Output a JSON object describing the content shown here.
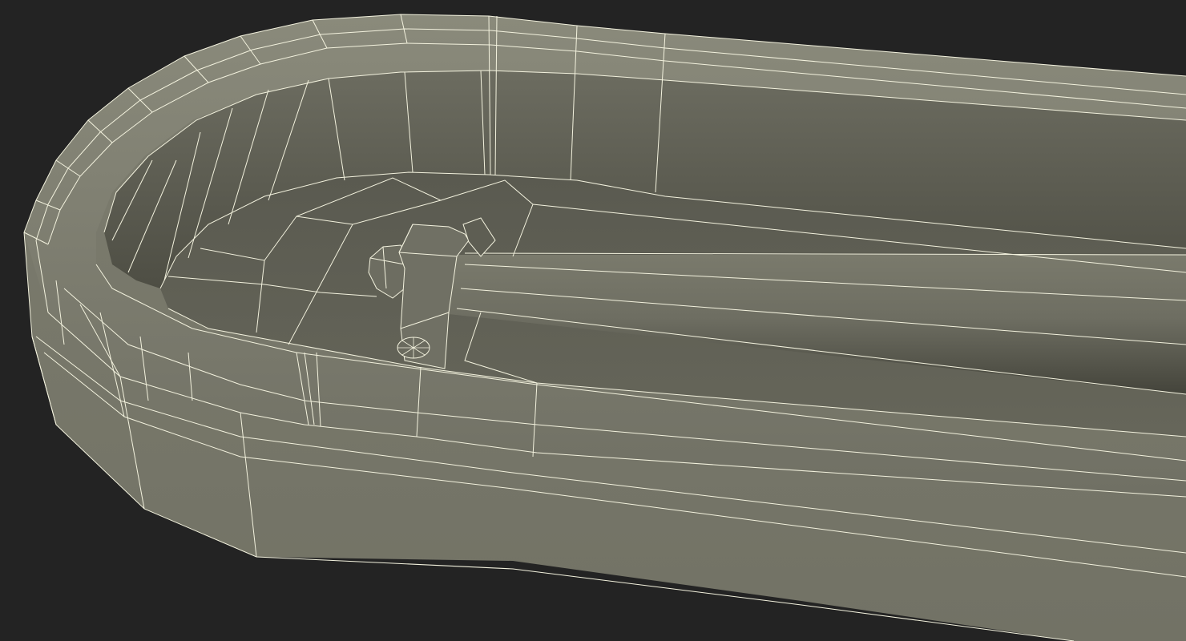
{
  "scene": {
    "subject": "wireframe-render",
    "background_color": "#232323",
    "surface_light": "#7a7a6c",
    "surface_mid": "#6a6a5e",
    "surface_dark": "#555548",
    "surface_floor": "#5f5f54",
    "wire_color": "#f3f2de"
  }
}
